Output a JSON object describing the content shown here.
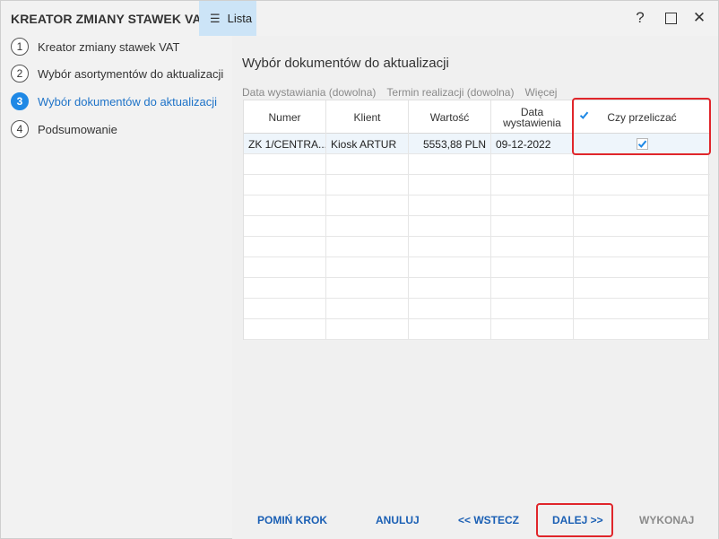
{
  "window": {
    "title": "KREATOR ZMIANY STAWEK VAT",
    "tab_label": "Lista",
    "help_symbol": "?",
    "close_symbol": "✕"
  },
  "steps": [
    {
      "num": "1",
      "label": "Kreator zmiany stawek VAT",
      "active": false
    },
    {
      "num": "2",
      "label": "Wybór asortymentów do aktualizacji",
      "active": false
    },
    {
      "num": "3",
      "label": "Wybór dokumentów do aktualizacji",
      "active": true
    },
    {
      "num": "4",
      "label": "Podsumowanie",
      "active": false
    }
  ],
  "main": {
    "section_title": "Wybór dokumentów do aktualizacji",
    "filters": [
      "Data wystawiania (dowolna)",
      "Termin realizacji (dowolna)",
      "Więcej"
    ]
  },
  "table": {
    "headers": [
      "Numer",
      "Klient",
      "Wartość",
      "Data wystawienia",
      "Czy przeliczać"
    ],
    "header_check_all": true,
    "rows": [
      {
        "numer": "ZK 1/CENTRA...",
        "klient": "Kiosk ARTUR",
        "wartosc": "5553,88 PLN",
        "data": "09-12-2022",
        "przeliczac": true
      }
    ],
    "empty_rows": 9
  },
  "footer": {
    "skip": "POMIŃ KROK",
    "cancel": "ANULUJ",
    "back": "<< WSTECZ",
    "next": "DALEJ >>",
    "execute": "WYKONAJ"
  },
  "colors": {
    "accent": "#1e88e5",
    "highlight": "#e0262b",
    "tab_bg": "#cce4f7"
  }
}
